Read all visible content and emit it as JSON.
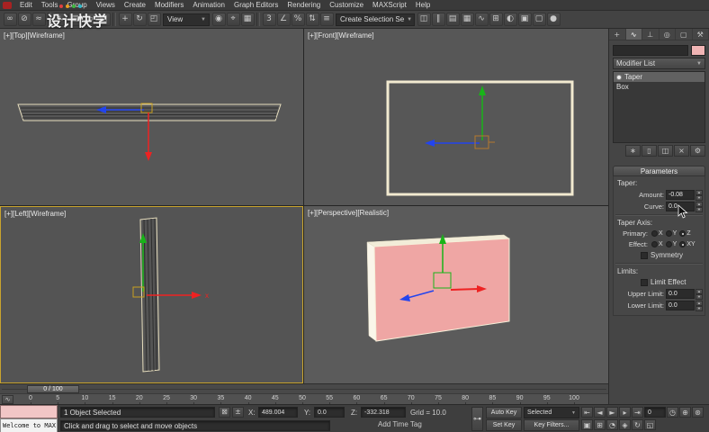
{
  "menu": {
    "items": [
      "Edit",
      "Tools",
      "Group",
      "Views",
      "Create",
      "Modifiers",
      "Animation",
      "Graph Editors",
      "Rendering",
      "Customize",
      "MAXScript",
      "Help"
    ]
  },
  "watermark": {
    "text": "设计快学",
    "dot_colors": [
      "#e04040",
      "#e8a020",
      "#40b840",
      "#30b8c8"
    ]
  },
  "toolbar": {
    "items": [
      {
        "t": "icon",
        "name": "select-and-link-icon",
        "g": "∞"
      },
      {
        "t": "icon",
        "name": "unlink-selection-icon",
        "g": "⊘"
      },
      {
        "t": "icon",
        "name": "bind-to-space-warp-icon",
        "g": "≈"
      },
      {
        "t": "sep"
      },
      {
        "t": "icon",
        "name": "select-object-icon",
        "g": "↖"
      },
      {
        "t": "icon",
        "name": "select-by-name-icon",
        "g": "▤"
      },
      {
        "t": "icon",
        "name": "rectangular-selection-icon",
        "g": "▭"
      },
      {
        "t": "icon",
        "name": "window-crossing-icon",
        "g": "◱"
      },
      {
        "t": "sep"
      },
      {
        "t": "icon",
        "name": "select-and-move-icon",
        "g": "+"
      },
      {
        "t": "icon",
        "name": "select-and-rotate-icon",
        "g": "↻"
      },
      {
        "t": "icon",
        "name": "select-and-scale-icon",
        "g": "◰"
      },
      {
        "t": "dropdown",
        "name": "reference-coordinate-system-dropdown",
        "label": "View",
        "w": 52
      },
      {
        "t": "icon",
        "name": "use-pivot-point-center-icon",
        "g": "◉"
      },
      {
        "t": "icon",
        "name": "select-and-manipulate-icon",
        "g": "⌖"
      },
      {
        "t": "icon",
        "name": "keyboard-shortcut-override-icon",
        "g": "▦"
      },
      {
        "t": "sep"
      },
      {
        "t": "icon",
        "name": "snap-toggle-3d-icon",
        "g": "3"
      },
      {
        "t": "icon",
        "name": "angle-snap-icon",
        "g": "∠"
      },
      {
        "t": "icon",
        "name": "percent-snap-icon",
        "g": "%"
      },
      {
        "t": "icon",
        "name": "spinner-snap-icon",
        "g": "⇅"
      },
      {
        "t": "icon",
        "name": "edit-named-selection-sets-icon",
        "g": "≡"
      },
      {
        "t": "dropdown",
        "name": "named-selection-sets-dropdown",
        "label": "Create Selection Se",
        "w": 88
      },
      {
        "t": "icon",
        "name": "mirror-icon",
        "g": "◫"
      },
      {
        "t": "icon",
        "name": "align-icon",
        "g": "∥"
      },
      {
        "t": "icon",
        "name": "layer-manager-icon",
        "g": "▤"
      },
      {
        "t": "icon",
        "name": "graphite-ribbon-icon",
        "g": "▦"
      },
      {
        "t": "icon",
        "name": "curve-editor-icon",
        "g": "∿"
      },
      {
        "t": "icon",
        "name": "schematic-view-icon",
        "g": "⊞"
      },
      {
        "t": "icon",
        "name": "material-editor-icon",
        "g": "◐"
      },
      {
        "t": "icon",
        "name": "render-setup-icon",
        "g": "▣"
      },
      {
        "t": "icon",
        "name": "rendered-frame-window-icon",
        "g": "▢"
      },
      {
        "t": "icon",
        "name": "render-production-icon",
        "g": "●"
      }
    ]
  },
  "viewports": {
    "top_label": "[+][Top][Wireframe]",
    "front_label": "[+][Front][Wireframe]",
    "left_label": "[+][Left][Wireframe]",
    "persp_label": "[+][Perspective][Realistic]",
    "axis_x_label": "x",
    "object_color": "#efa6a4"
  },
  "command_panel": {
    "tabs": [
      {
        "name": "tab-create",
        "glyph": "+",
        "active": false
      },
      {
        "name": "tab-modify",
        "glyph": "∿",
        "active": true
      },
      {
        "name": "tab-hierarchy",
        "glyph": "⊥",
        "active": false
      },
      {
        "name": "tab-motion",
        "glyph": "◎",
        "active": false
      },
      {
        "name": "tab-display",
        "glyph": "▢",
        "active": false
      },
      {
        "name": "tab-utilities",
        "glyph": "⚒",
        "active": false
      }
    ],
    "object_color_swatch": "#f0b4b4",
    "modifier_list_label": "Modifier List",
    "stack_rows": [
      {
        "label": "Taper",
        "selected": true,
        "bulb": true
      },
      {
        "label": "Box",
        "selected": false,
        "bulb": false
      }
    ],
    "stack_buttons": [
      {
        "name": "pin-stack-button",
        "glyph": "∗"
      },
      {
        "name": "show-end-result-button",
        "glyph": "▯"
      },
      {
        "name": "make-unique-button",
        "glyph": "◫"
      },
      {
        "name": "remove-modifier-button",
        "glyph": "×"
      },
      {
        "name": "configure-modifier-sets-button",
        "glyph": "⚙"
      }
    ],
    "parameters": {
      "header": "Parameters",
      "taper_group_label": "Taper:",
      "amount_label": "Amount:",
      "amount_value": "-0.08",
      "curve_label": "Curve:",
      "curve_value": "0.0",
      "axis_group_label": "Taper Axis:",
      "primary_label": "Primary:",
      "primary_options": [
        "X",
        "Y",
        "Z"
      ],
      "primary_selected": "Z",
      "effect_label": "Effect:",
      "effect_options": [
        "X",
        "Y",
        "XY"
      ],
      "effect_selected": "XY",
      "symmetry_label": "Symmetry",
      "symmetry_checked": false,
      "limits_group_label": "Limits:",
      "limit_effect_label": "Limit Effect",
      "limit_effect_checked": false,
      "upper_limit_label": "Upper Limit:",
      "upper_limit_value": "0.0",
      "lower_limit_label": "Lower Limit:",
      "lower_limit_value": "0.0"
    }
  },
  "timeline": {
    "slider_label": "0 / 100",
    "ticks": [
      "0",
      "5",
      "10",
      "15",
      "20",
      "25",
      "30",
      "35",
      "40",
      "45",
      "50",
      "55",
      "60",
      "65",
      "70",
      "75",
      "80",
      "85",
      "90",
      "95",
      "100"
    ],
    "mini_curve_editor_glyph": "∿"
  },
  "status_bar": {
    "mini_listener_text": "Welcome to MAX",
    "selection_status": "1 Object Selected",
    "prompt": "Click and drag to select and move objects",
    "lock_glyph": "⊠",
    "absolute_mode_glyph": "±",
    "x_label": "X:",
    "x_value": "489.004",
    "y_label": "Y:",
    "y_value": "0.0",
    "z_label": "Z:",
    "z_value": "-332.318",
    "grid_label": "Grid = 10.0",
    "add_time_tag": "Add Time Tag",
    "set_keys_glyph": "⊶",
    "auto_key_label": "Auto Key",
    "set_key_label": "Set Key",
    "key_mode_dropdown": "Selected",
    "key_filters_label": "Key Filters...",
    "frame_value": "0",
    "playback": [
      {
        "name": "go-to-start-button",
        "glyph": "⇤"
      },
      {
        "name": "previous-frame-button",
        "glyph": "◄"
      },
      {
        "name": "play-button",
        "glyph": "►"
      },
      {
        "name": "next-frame-button",
        "glyph": "▸"
      },
      {
        "name": "go-to-end-button",
        "glyph": "⇥"
      }
    ],
    "time_config_glyph": "◷",
    "nav_row1": [
      {
        "name": "zoom-button",
        "glyph": "⊕"
      },
      {
        "name": "zoom-all-button",
        "glyph": "⊛"
      }
    ],
    "nav_row2": [
      {
        "name": "zoom-extents-button",
        "glyph": "▣"
      },
      {
        "name": "zoom-extents-all-button",
        "glyph": "⊞"
      },
      {
        "name": "field-of-view-button",
        "glyph": "◔"
      },
      {
        "name": "pan-button",
        "glyph": "◈"
      },
      {
        "name": "orbit-button",
        "glyph": "↻"
      },
      {
        "name": "maximize-viewport-button",
        "glyph": "◱"
      }
    ]
  }
}
